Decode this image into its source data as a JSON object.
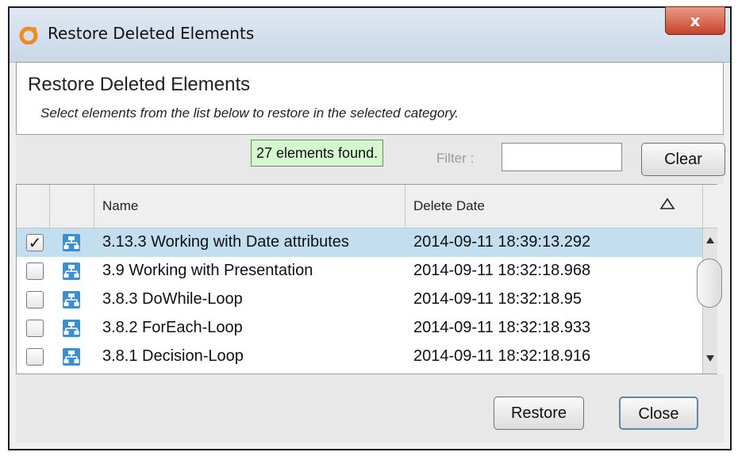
{
  "window": {
    "title": "Restore Deleted Elements",
    "close_label": "x"
  },
  "header": {
    "title": "Restore Deleted Elements",
    "description": "Select elements from the list below to restore in the selected category."
  },
  "toolbar": {
    "found_text": "27 elements found.",
    "filter_label": "Filter :",
    "filter_value": "",
    "clear_label": "Clear"
  },
  "table": {
    "columns": {
      "name": "Name",
      "delete_date": "Delete Date"
    },
    "sort": "ascending",
    "rows": [
      {
        "checked": true,
        "checkmark": "✓",
        "name": "3.13.3 Working with Date attributes",
        "date": "2014-09-11 18:39:13.292"
      },
      {
        "checked": false,
        "checkmark": "",
        "name": "3.9 Working with Presentation",
        "date": "2014-09-11 18:32:18.968"
      },
      {
        "checked": false,
        "checkmark": "",
        "name": "3.8.3 DoWhile-Loop",
        "date": "2014-09-11 18:32:18.95"
      },
      {
        "checked": false,
        "checkmark": "",
        "name": "3.8.2 ForEach-Loop",
        "date": "2014-09-11 18:32:18.933"
      },
      {
        "checked": false,
        "checkmark": "",
        "name": "3.8.1 Decision-Loop",
        "date": "2014-09-11 18:32:18.916"
      }
    ]
  },
  "footer": {
    "restore_label": "Restore",
    "close_label": "Close"
  },
  "colors": {
    "selected_row": "#c3deef",
    "found_badge_bg": "#d4f7cf",
    "close_button": "#c7432c",
    "element_icon": "#3a8fd4"
  }
}
